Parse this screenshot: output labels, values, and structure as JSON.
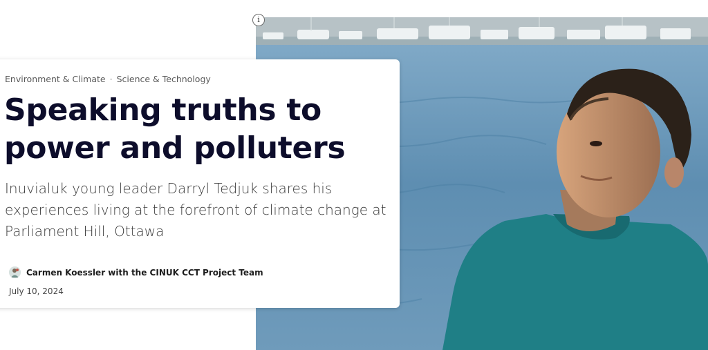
{
  "article": {
    "tags": [
      "Environment & Climate",
      "Science & Technology"
    ],
    "tag_separator": "·",
    "title": "Speaking truths to power and polluters",
    "subtitle": "Inuvialuk young leader Darryl Tedjuk shares his experiences living at the forefront of climate change at Parliament Hill, Ottawa",
    "author": "Carmen Koessler with the CINUK CCT Project Team",
    "date": "July 10, 2024"
  },
  "info_icon": {
    "glyph": "i",
    "icon": "info-icon"
  },
  "colors": {
    "title": "#0d0d2b",
    "water": "#5f8db0",
    "shirt": "#1f7f86",
    "skin": "#b98a66",
    "hair": "#2b2119"
  }
}
